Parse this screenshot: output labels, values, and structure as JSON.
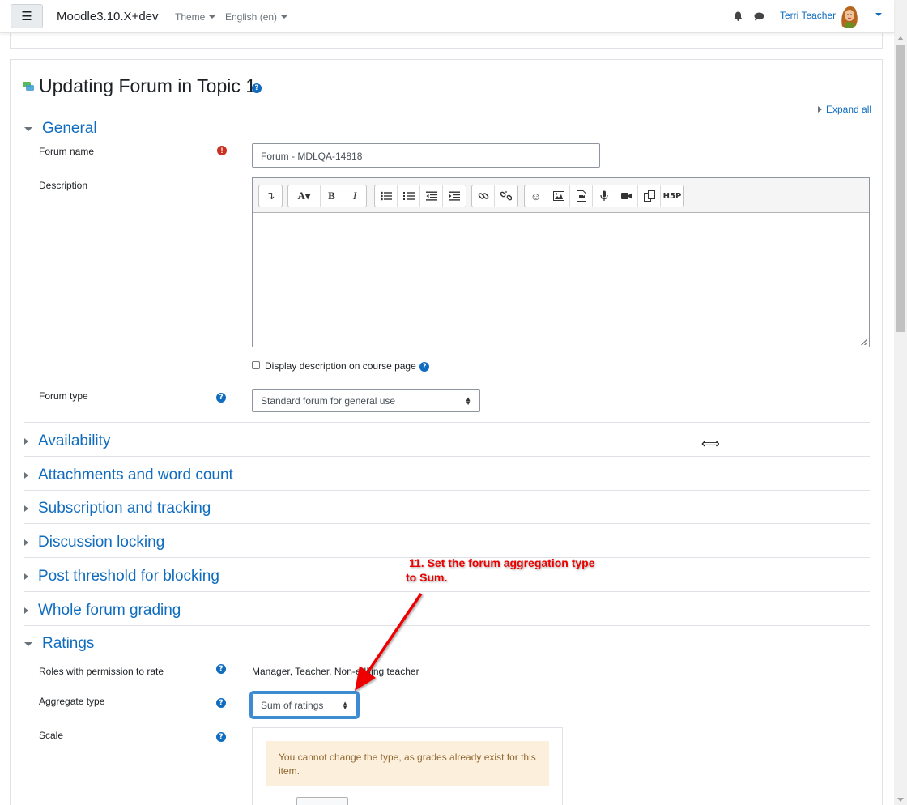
{
  "navbar": {
    "menu_icon": "hamburger-icon",
    "brand": "Moodle3.10.X+dev",
    "theme_label": "Theme",
    "language_label": "English (en)",
    "notifications_icon": "bell-icon",
    "messages_icon": "chat-icon",
    "user_name": "Terri Teacher"
  },
  "page": {
    "title": "Updating Forum in Topic 1",
    "expand_all": "Expand all"
  },
  "general": {
    "heading": "General",
    "forum_name_label": "Forum name",
    "forum_name_value": "Forum - MDLQA-14818",
    "description_label": "Description",
    "display_description_label": "Display description on course page",
    "forum_type_label": "Forum type",
    "forum_type_value": "Standard forum for general use"
  },
  "editor": {
    "toolbar": [
      "toggle-toolbar",
      "font-style",
      "bold",
      "italic",
      "bullet-list",
      "numbered-list",
      "outdent",
      "indent",
      "link",
      "unlink",
      "emoji",
      "image",
      "media",
      "record-audio",
      "record-video",
      "manage-files",
      "h5p"
    ]
  },
  "sections": [
    "Availability",
    "Attachments and word count",
    "Subscription and tracking",
    "Discussion locking",
    "Post threshold for blocking",
    "Whole forum grading"
  ],
  "ratings": {
    "heading": "Ratings",
    "roles_label": "Roles with permission to rate",
    "roles_value": "Manager, Teacher, Non-editing teacher",
    "aggregate_label": "Aggregate type",
    "aggregate_value": "Sum of ratings",
    "scale_label": "Scale",
    "scale_warning": "You cannot change the type, as grades already exist for this item."
  },
  "annotation": {
    "line1": "11. Set the forum aggregation type",
    "line2": "to Sum.",
    "color": "#e00000"
  },
  "colors": {
    "link": "#0f6cbf",
    "required": "#ca3120",
    "focus": "#3d8bd0",
    "alert_bg": "#fcefdc"
  }
}
